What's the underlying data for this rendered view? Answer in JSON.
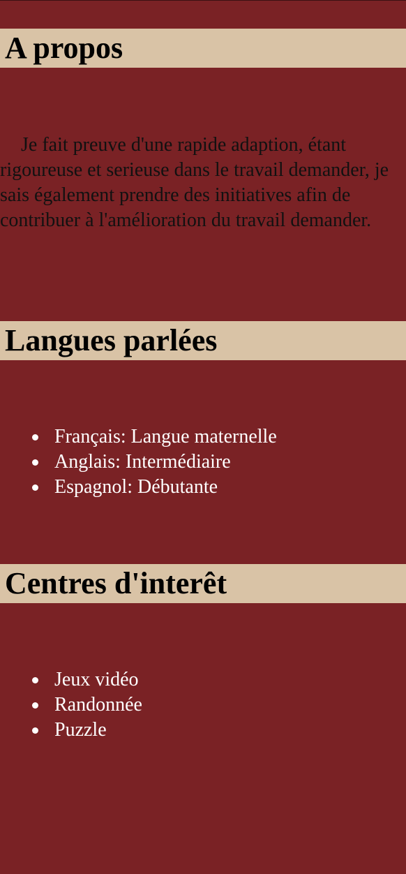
{
  "about": {
    "title": "A propos",
    "text": "Je fait preuve d'une rapide adaption, étant rigoureuse et serieuse dans le travail demander, je sais également prendre des initiatives afin de contribuer à l'amélioration du travail demander."
  },
  "languages": {
    "title": "Langues parlées",
    "items": [
      "Français: Langue maternelle",
      "Anglais: Intermédiaire",
      "Espagnol: Débutante"
    ]
  },
  "interests": {
    "title": "Centres d'interêt",
    "items": [
      "Jeux vidéo",
      "Randonnée",
      "Puzzle"
    ]
  },
  "colors": {
    "background": "#7a2225",
    "header_band": "#d9c3a6",
    "list_text": "#ffffff",
    "paragraph_text": "#111111"
  }
}
